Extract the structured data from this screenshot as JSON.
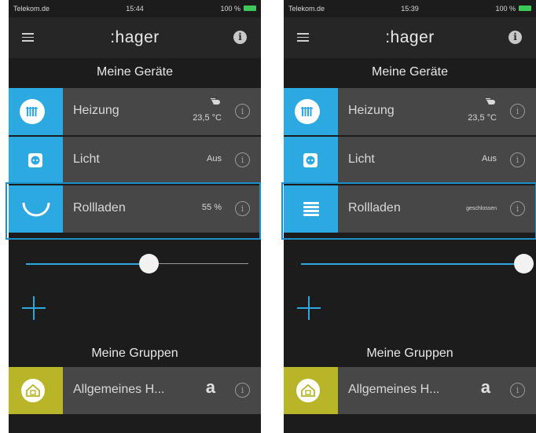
{
  "screens": [
    {
      "status": {
        "carrier": "Telekom.de",
        "time": "15:44",
        "battery": "100 %"
      },
      "header": {
        "brand": ":hager"
      },
      "section_devices": "Meine Geräte",
      "devices": [
        {
          "name": "Heizung",
          "value": "23,5 °C",
          "icon": "radiator-icon"
        },
        {
          "name": "Licht",
          "value": "Aus",
          "icon": "socket-icon"
        },
        {
          "name": "Rollladen",
          "value": "55 %",
          "icon": "shutter-half-icon"
        }
      ],
      "slider": {
        "level_percent": 55
      },
      "section_groups": "Meine Gruppen",
      "groups": [
        {
          "name": "Allgemeines H...",
          "badge": "a",
          "icon": "house-icon"
        }
      ]
    },
    {
      "status": {
        "carrier": "Telekom.de",
        "time": "15:39",
        "battery": "100 %"
      },
      "header": {
        "brand": ":hager"
      },
      "section_devices": "Meine Geräte",
      "devices": [
        {
          "name": "Heizung",
          "value": "23,5 °C",
          "icon": "radiator-icon"
        },
        {
          "name": "Licht",
          "value": "Aus",
          "icon": "socket-icon"
        },
        {
          "name": "Rollladen",
          "value": "geschlossen",
          "icon": "shutter-closed-icon"
        }
      ],
      "slider": {
        "level_percent": 100
      },
      "section_groups": "Meine Gruppen",
      "groups": [
        {
          "name": "Allgemeines H...",
          "badge": "a",
          "icon": "house-icon"
        }
      ]
    }
  ],
  "colors": {
    "accent": "#2ba9e0",
    "group_tile": "#b8b628",
    "highlight_border": "#1b8fc8"
  }
}
